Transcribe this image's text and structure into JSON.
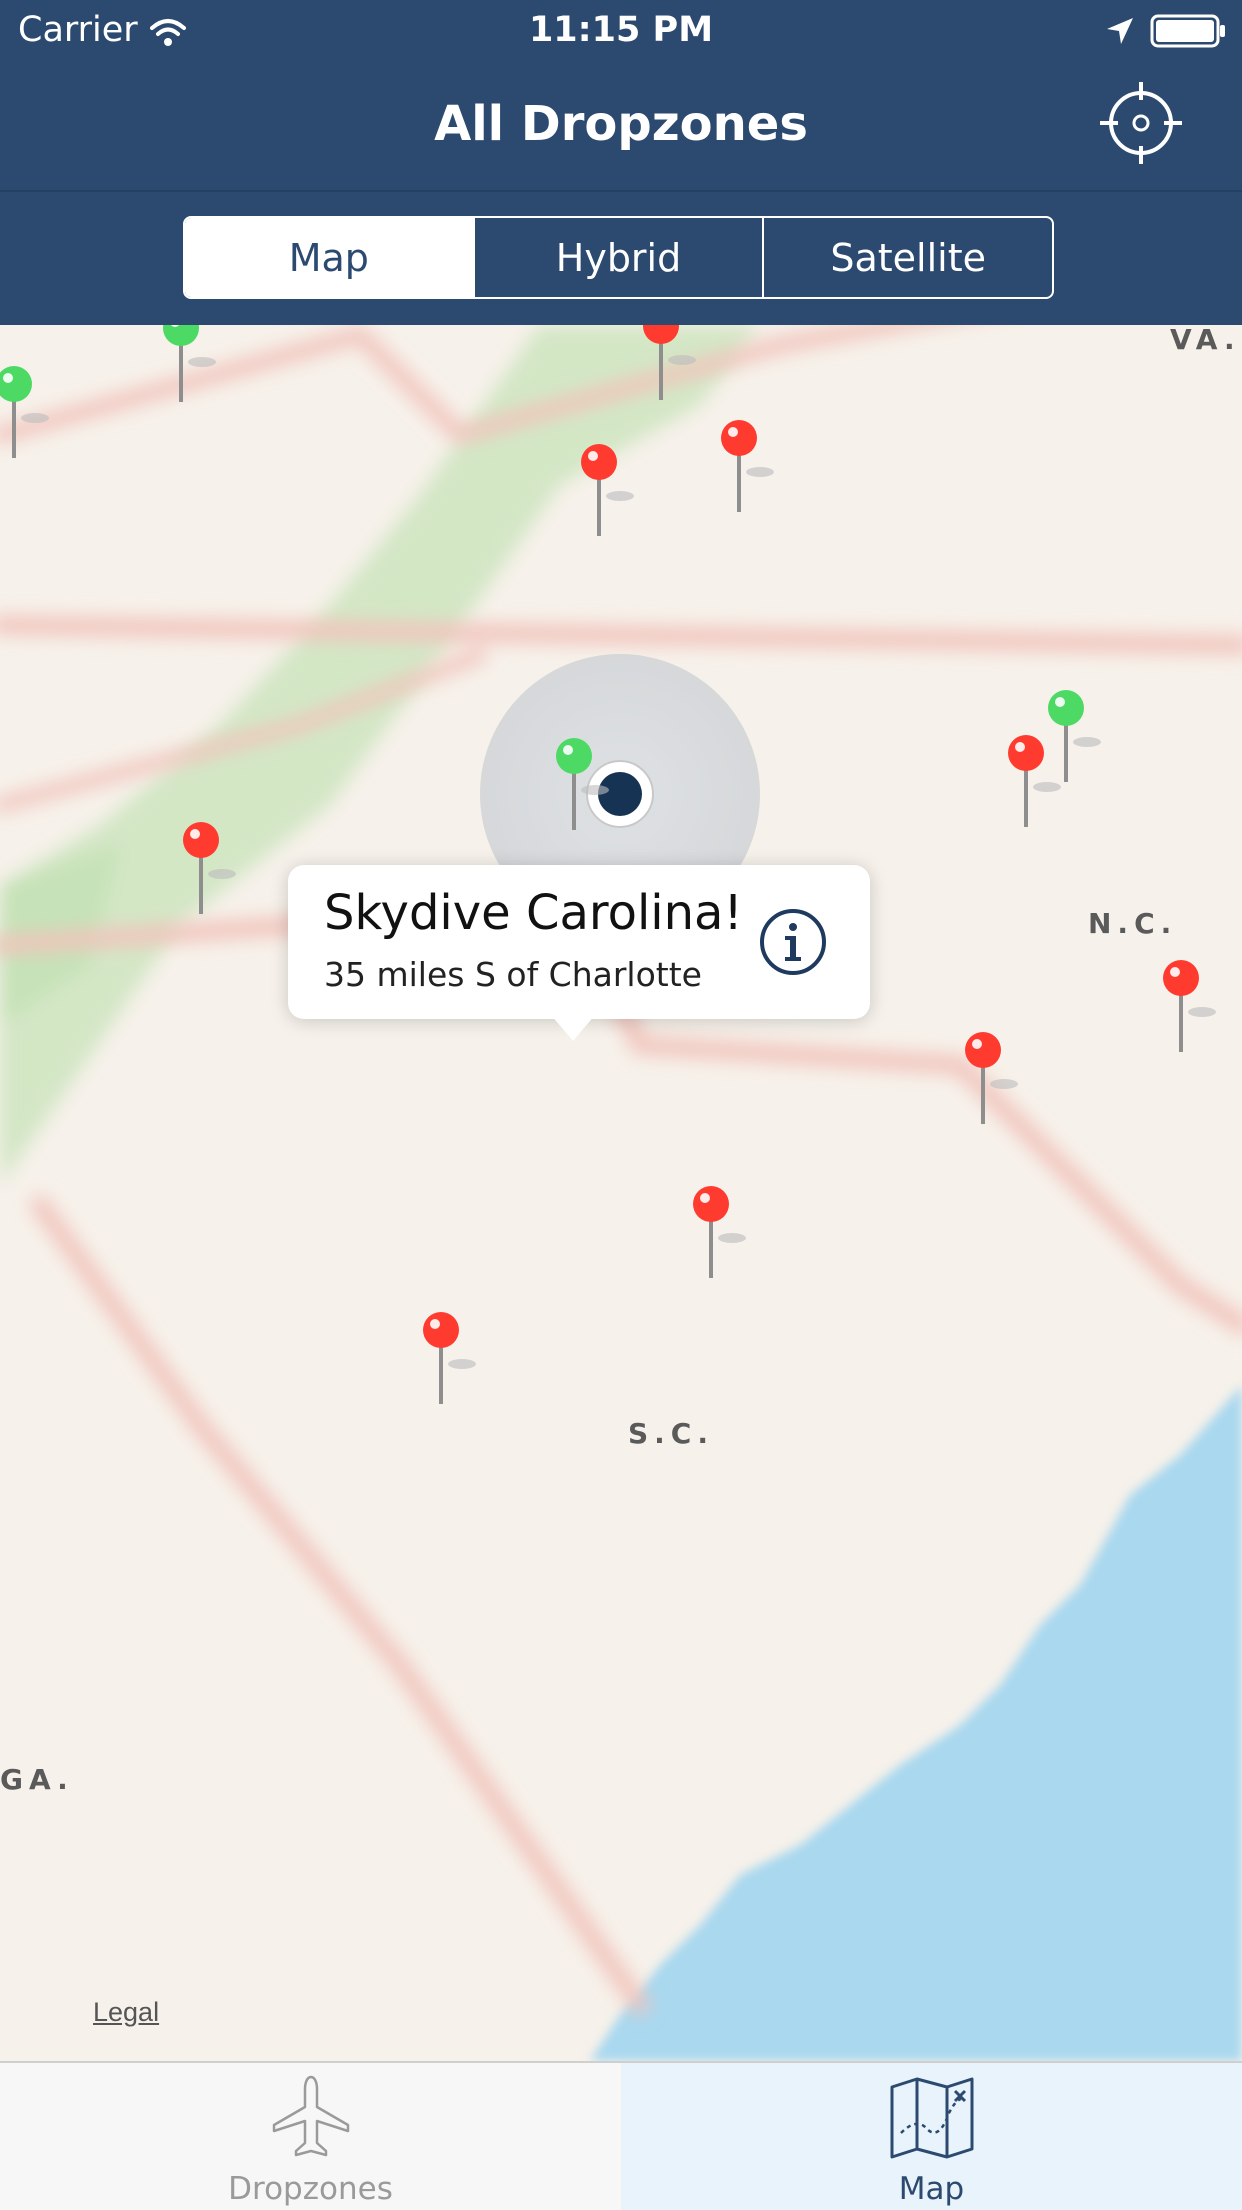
{
  "status_bar": {
    "carrier": "Carrier",
    "time": "11:15 PM",
    "icons": [
      "wifi-icon",
      "location-arrow-icon",
      "battery-icon"
    ]
  },
  "nav": {
    "title": "All Dropzones",
    "right_button_icon": "crosshair-locate-icon"
  },
  "map_type_control": {
    "segments": [
      "Map",
      "Hybrid",
      "Satellite"
    ],
    "selected": "Map"
  },
  "map": {
    "state_labels": [
      "VA.",
      "N.C.",
      "S.C.",
      "GA."
    ],
    "legal_label": "Legal",
    "pin_colors": {
      "green": "#4cd964",
      "red": "#ff3b30"
    },
    "callout": {
      "title": "Skydive Carolina!",
      "subtitle": "35 miles S of Charlotte",
      "accessory_icon": "info-icon"
    }
  },
  "tab_bar": {
    "tabs": [
      {
        "label": "Dropzones",
        "icon": "airplane-icon",
        "active": false
      },
      {
        "label": "Map",
        "icon": "map-icon",
        "active": true
      }
    ]
  },
  "colors": {
    "nav_bg": "#2c4a70",
    "water": "#a9d8ef",
    "land": "#f6f1ea",
    "park": "#cfe7c2"
  }
}
